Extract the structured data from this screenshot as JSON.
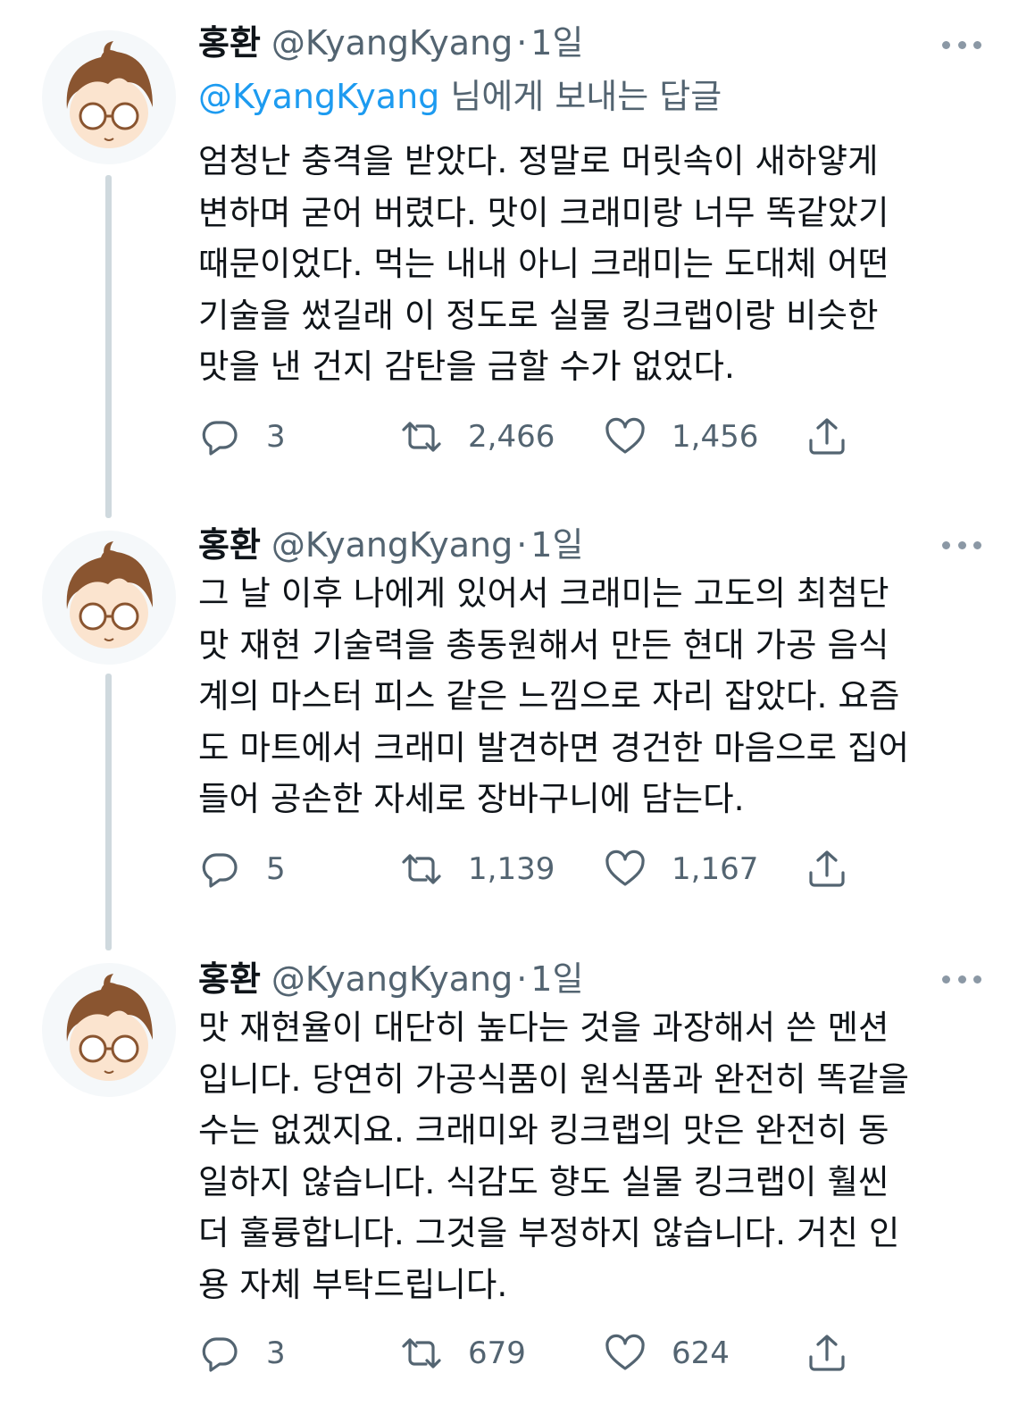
{
  "tweets": [
    {
      "name": "홍환",
      "handle": "@KyangKyang",
      "dot": "·",
      "time": "1일",
      "reply_to": {
        "mention": "@KyangKyang",
        "suffix": " 님에게 보내는 답글"
      },
      "lines": [
        "엄청난 충격을 받았다. 정말로 머릿속이 새하얗게",
        "변하며 굳어 버렸다. 맛이 크래미랑 너무 똑같았기",
        "때문이었다. 먹는 내내 아니 크래미는 도대체 어떤",
        "기술을 썼길래 이 정도로 실물 킹크랩이랑 비슷한",
        "맛을 낸 건지 감탄을 금할 수가 없었다."
      ],
      "replies": "3",
      "retweets": "2,466",
      "likes": "1,456"
    },
    {
      "name": "홍환",
      "handle": "@KyangKyang",
      "dot": "·",
      "time": "1일",
      "lines": [
        "그 날 이후 나에게 있어서 크래미는 고도의 최첨단",
        "맛 재현 기술력을 총동원해서 만든 현대 가공 음식",
        "계의 마스터 피스 같은 느낌으로 자리 잡았다. 요즘",
        "도 마트에서 크래미 발견하면 경건한 마음으로 집어",
        "들어  공손한 자세로 장바구니에 담는다."
      ],
      "replies": "5",
      "retweets": "1,139",
      "likes": "1,167"
    },
    {
      "name": "홍환",
      "handle": "@KyangKyang",
      "dot": "·",
      "time": "1일",
      "lines": [
        "맛 재현율이 대단히 높다는 것을 과장해서 쓴 멘션",
        "입니다. 당연히 가공식품이 원식품과 완전히 똑같을",
        "수는 없겠지요. 크래미와 킹크랩의 맛은 완전히 동",
        "일하지 않습니다. 식감도 향도 실물 킹크랩이 훨씬",
        "더 훌륭합니다. 그것을 부정하지 않습니다. 거친 인",
        "용 자체 부탁드립니다."
      ],
      "replies": "3",
      "retweets": "679",
      "likes": "624"
    }
  ],
  "icons": {
    "reply": "reply-icon",
    "retweet": "retweet-icon",
    "like": "heart-icon",
    "share": "share-icon",
    "more": "more-icon"
  },
  "colors": {
    "text": "#0f1419",
    "secondary": "#536471",
    "link": "#1d9bf0",
    "thread_line": "#cfd9de"
  }
}
